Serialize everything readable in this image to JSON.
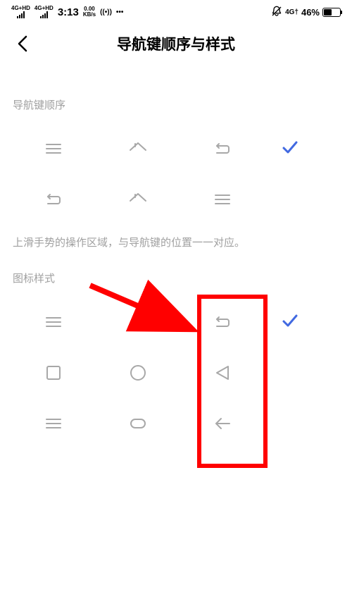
{
  "statusBar": {
    "network1": "4G+HD",
    "network2": "4G+HD",
    "time": "3:13",
    "dataRateTop": "0.00",
    "dataRateBottom": "KB/s",
    "wifiSignal": "((•))",
    "extra": "•••",
    "networkRight": "4G†",
    "batteryPercent": "46%",
    "batteryFillWidth": "46%"
  },
  "header": {
    "title": "导航键顺序与样式"
  },
  "sectionOrder": {
    "title": "导航键顺序",
    "caption": "上滑手势的操作区域，与导航键的位置一一对应。"
  },
  "sectionStyle": {
    "title": "图标样式"
  }
}
